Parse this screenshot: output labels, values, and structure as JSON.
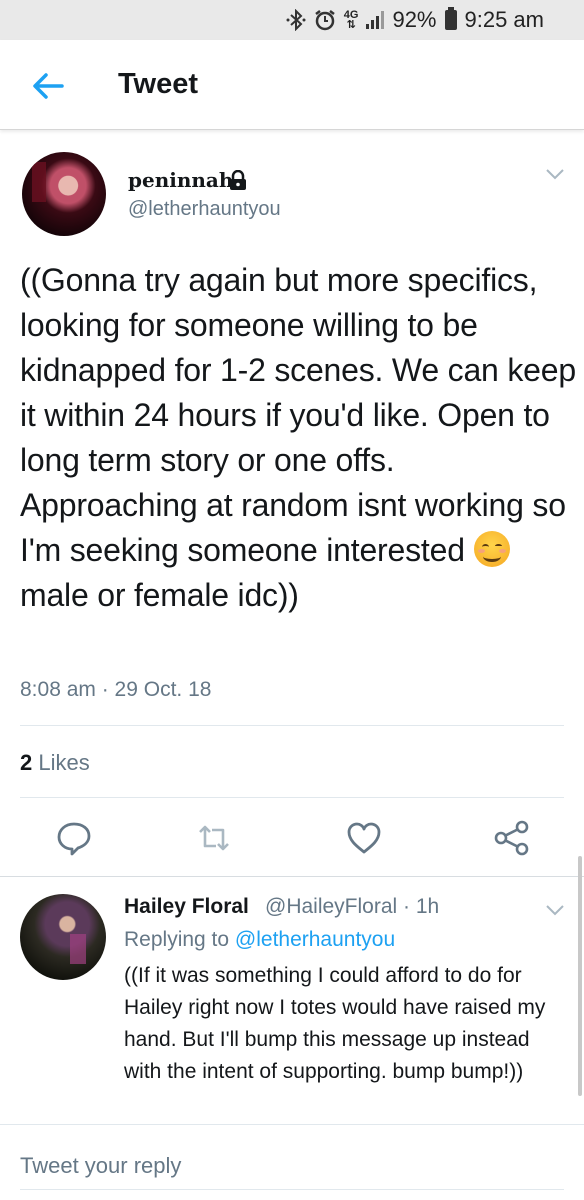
{
  "status_bar": {
    "bluetooth_icon": "bluetooth-icon",
    "alarm_icon": "alarm-icon",
    "network_type": "4G",
    "battery": "92%",
    "time": "9:25 am"
  },
  "header": {
    "back_icon": "arrow-left-icon",
    "title": "Tweet"
  },
  "tweet": {
    "author_name": "peninnah",
    "protected_icon": "lock-icon",
    "handle": "@letherhauntyou",
    "text_before_emoji": "((Gonna try again but more specifics, looking for someone willing to be kidnapped for 1-2 scenes. We can keep it within 24 hours if you'd like. Open to long term story or one offs. Approaching at random isnt working so I'm seeking someone interested ",
    "emoji": "smiling-face-emoji",
    "text_after_emoji": " male or female idc))",
    "timestamp": "8:08 am · 29 Oct. 18",
    "likes_count": "2",
    "likes_label": " Likes",
    "actions": [
      "reply-icon",
      "retweet-icon",
      "heart-icon",
      "share-icon"
    ]
  },
  "reply": {
    "author_name": "Hailey Floral",
    "meta": "@HaileyFloral · 1h",
    "replying_prefix": "Replying to ",
    "replying_to": "@letherhauntyou",
    "text": "((If it was something I could afford to do for Hailey right now I totes would have raised my hand.  But I'll bump this message up instead with the intent of supporting.  bump bump!))"
  },
  "compose": {
    "placeholder": "Tweet your reply"
  },
  "colors": {
    "accent": "#1da1f2",
    "secondary_text": "#657786",
    "primary_text": "#14171a",
    "status_bar_bg": "#e9e9e9"
  }
}
